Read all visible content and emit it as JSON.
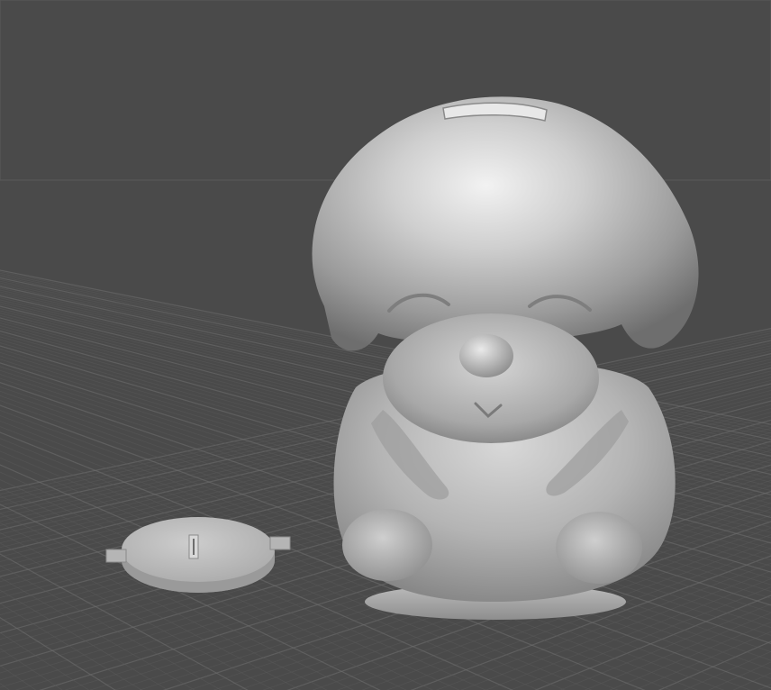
{
  "viewport": {
    "background_color": "#4a4a4a",
    "grid_minor_color": "#5a5a5a",
    "grid_major_color": "#707070",
    "model_base_color": "#c8c8c8"
  },
  "scene": {
    "grid": {
      "visible": true
    },
    "objects": [
      {
        "name": "piggy-bank-puppy-body",
        "type": "3d-mesh"
      },
      {
        "name": "coin-slot-lid",
        "type": "3d-mesh"
      }
    ]
  }
}
